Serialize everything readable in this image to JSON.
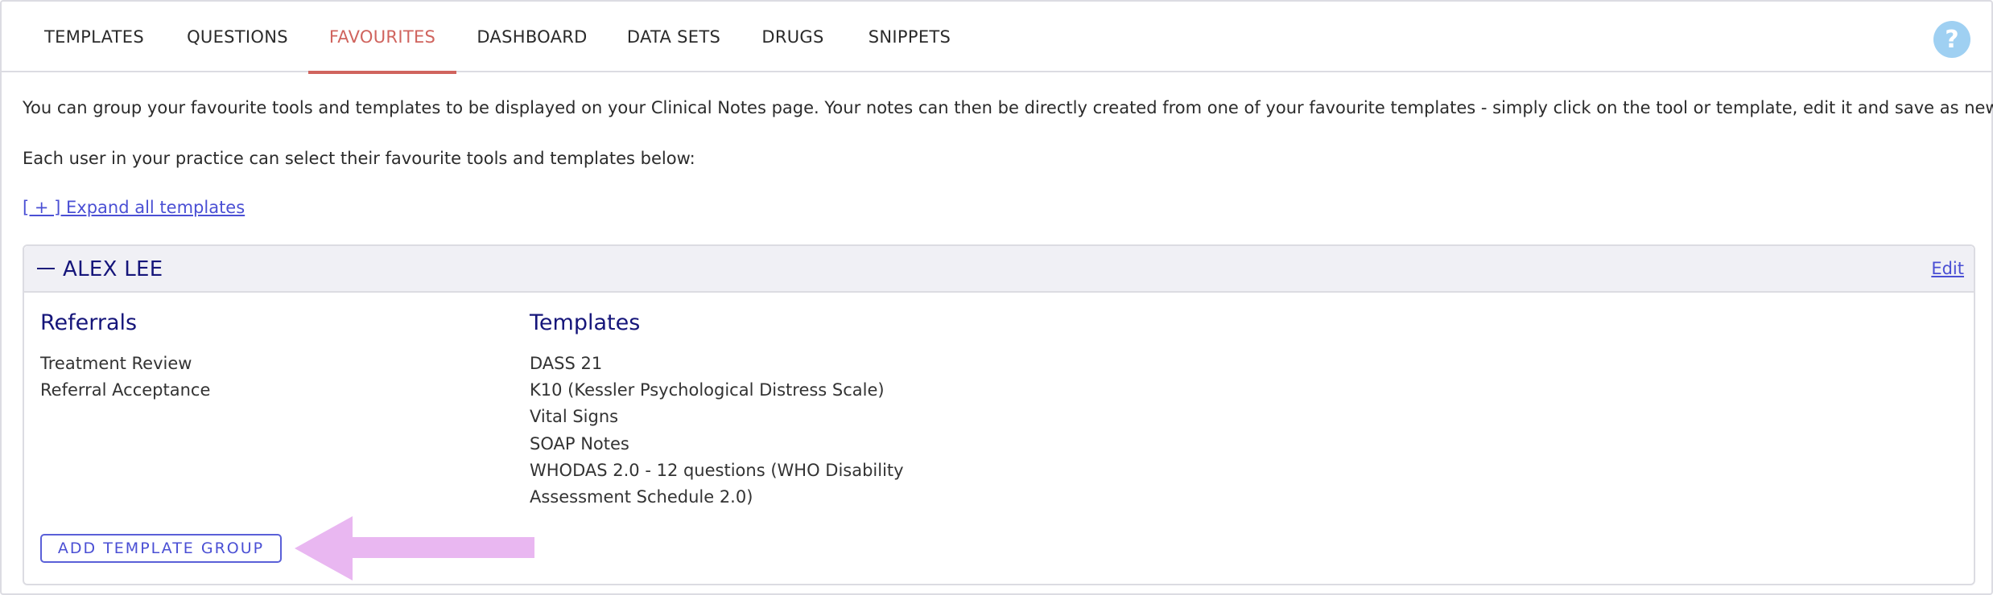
{
  "nav": {
    "tabs": [
      {
        "label": "TEMPLATES"
      },
      {
        "label": "QUESTIONS"
      },
      {
        "label": "FAVOURITES"
      },
      {
        "label": "DASHBOARD"
      },
      {
        "label": "DATA SETS"
      },
      {
        "label": "DRUGS"
      },
      {
        "label": "SNIPPETS"
      }
    ],
    "active_tab": "FAVOURITES",
    "help_label": "?"
  },
  "intro": {
    "line1": "You can group your favourite tools and templates to be displayed on your Clinical Notes page. Your notes can then be directly created from one of your favourite templates - simply click on the tool or template, edit it and save as new note.",
    "line2": "Each user in your practice can select their favourite tools and templates below:"
  },
  "expand_link": "[ + ] Expand all templates",
  "user_card": {
    "name": "ALEX LEE",
    "edit_label": "Edit",
    "groups": [
      {
        "title": "Referrals",
        "items": [
          "Treatment Review",
          "Referral Acceptance"
        ]
      },
      {
        "title": "Templates",
        "items": [
          "DASS 21",
          "K10 (Kessler Psychological Distress Scale)",
          "Vital Signs",
          "SOAP Notes",
          "WHODAS 2.0 - 12 questions (WHO Disability",
          "Assessment Schedule 2.0)"
        ]
      }
    ],
    "add_button_label": "ADD TEMPLATE GROUP"
  },
  "colors": {
    "accent_active_tab": "#d0645e",
    "link": "#4a4fd4",
    "heading": "#15157a",
    "annotation_arrow": "#e9b7f1",
    "help_icon": "#9fd0f2"
  }
}
